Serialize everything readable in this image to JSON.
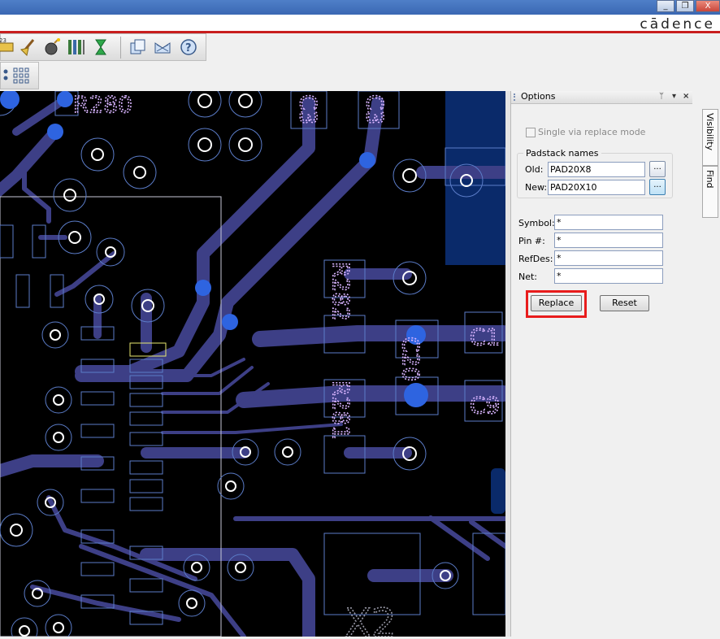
{
  "window": {
    "minimize_symbol": "_",
    "restore_symbol": "❐",
    "close_symbol": "X"
  },
  "brand": {
    "logo": "cādence"
  },
  "toolbar": {
    "icons": [
      "ruler-icon",
      "broom-icon",
      "bomb-icon",
      "bars-icon",
      "hourglass-icon",
      "copy-icon",
      "transfer-icon",
      "help-icon",
      "grid-icon",
      "dot-matrix-icon"
    ]
  },
  "canvas": {
    "silkscreen_labels": [
      "R280",
      "R282",
      "R281",
      "C3",
      "C3",
      "C20",
      "C1",
      "C9",
      "X2"
    ]
  },
  "options_panel": {
    "title": "Options",
    "pin_symbol": "ᛘ",
    "menu_symbol": "▾",
    "close_symbol": "×",
    "single_via_replace": {
      "label": "Single via replace mode",
      "checked": false
    },
    "padstack": {
      "group_label": "Padstack names",
      "old_label": "Old:",
      "old_value": "PAD20X8",
      "new_label": "New:",
      "new_value": "PAD20X10",
      "browse_label": "..."
    },
    "filters": {
      "symbol_label": "Symbol:",
      "symbol_value": "*",
      "pin_label": "Pin #:",
      "pin_value": "*",
      "refdes_label": "RefDes:",
      "refdes_value": "*",
      "net_label": "Net:",
      "net_value": "*"
    },
    "replace_button": "Replace",
    "reset_button": "Reset",
    "highlight_color": "#e81c1c"
  },
  "side_tabs": [
    {
      "label": "Visibility"
    },
    {
      "label": "Find"
    }
  ],
  "colors": {
    "board_bg": "#000000",
    "trace": "#3d3f86",
    "via_ring": "#5b7cc8",
    "silk": "#d8b4ff"
  }
}
